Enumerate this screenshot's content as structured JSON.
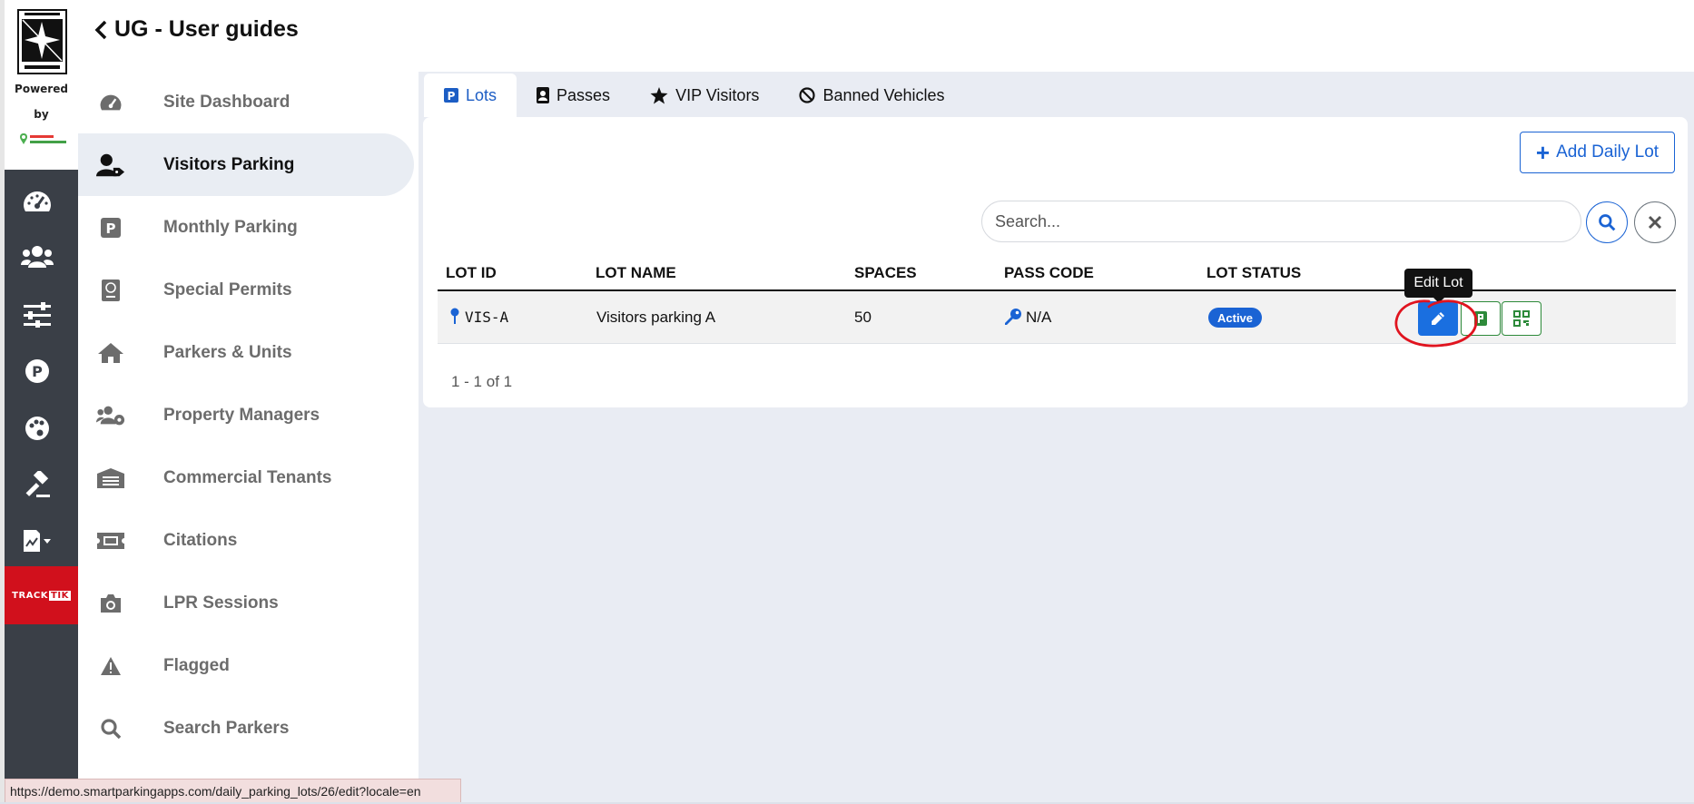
{
  "brand": {
    "powered": "Powered",
    "by": "by",
    "tracktik_a": "TRACK",
    "tracktik_b": "TIK"
  },
  "rail_icons": [
    "speedometer-icon",
    "users-icon",
    "sliders-icon",
    "parking-icon",
    "palette-icon",
    "gavel-icon",
    "file-signature-icon"
  ],
  "header": {
    "back_title": "UG - User guides"
  },
  "sidebar": {
    "items": [
      {
        "label": "Site Dashboard",
        "icon": "speedometer-icon"
      },
      {
        "label": "Visitors Parking",
        "icon": "user-tag-icon",
        "active": true
      },
      {
        "label": "Monthly Parking",
        "icon": "parking-icon"
      },
      {
        "label": "Special Permits",
        "icon": "passport-icon"
      },
      {
        "label": "Parkers & Units",
        "icon": "home-icon"
      },
      {
        "label": "Property Managers",
        "icon": "users-cog-icon"
      },
      {
        "label": "Commercial Tenants",
        "icon": "warehouse-icon"
      },
      {
        "label": "Citations",
        "icon": "ticket-icon"
      },
      {
        "label": "LPR Sessions",
        "icon": "camera-icon"
      },
      {
        "label": "Flagged",
        "icon": "warning-icon"
      },
      {
        "label": "Search Parkers",
        "icon": "search-icon"
      }
    ]
  },
  "tabs": [
    {
      "label": "Lots",
      "icon": "parking-square-icon",
      "active": true
    },
    {
      "label": "Passes",
      "icon": "id-badge-icon"
    },
    {
      "label": "VIP Visitors",
      "icon": "star-icon"
    },
    {
      "label": "Banned Vehicles",
      "icon": "ban-icon"
    }
  ],
  "toolbar": {
    "add_label": "Add Daily Lot",
    "search_placeholder": "Search..."
  },
  "table": {
    "headers": [
      "LOT ID",
      "LOT NAME",
      "SPACES",
      "PASS CODE",
      "LOT STATUS"
    ],
    "rows": [
      {
        "lot_id": "VIS-A",
        "lot_name": "Visitors parking A",
        "spaces": "50",
        "pass_code": "N/A",
        "status": "Active"
      }
    ],
    "pagination": "1 - 1 of 1"
  },
  "tooltip": "Edit Lot",
  "status_bar": "https://demo.smartparkingapps.com/daily_parking_lots/26/edit?locale=en",
  "colors": {
    "accent": "#1a63d4",
    "rail": "#3a3f47",
    "tracktik": "#d1101c",
    "main_bg": "#e9ecf3",
    "annotation": "#e0141f"
  }
}
